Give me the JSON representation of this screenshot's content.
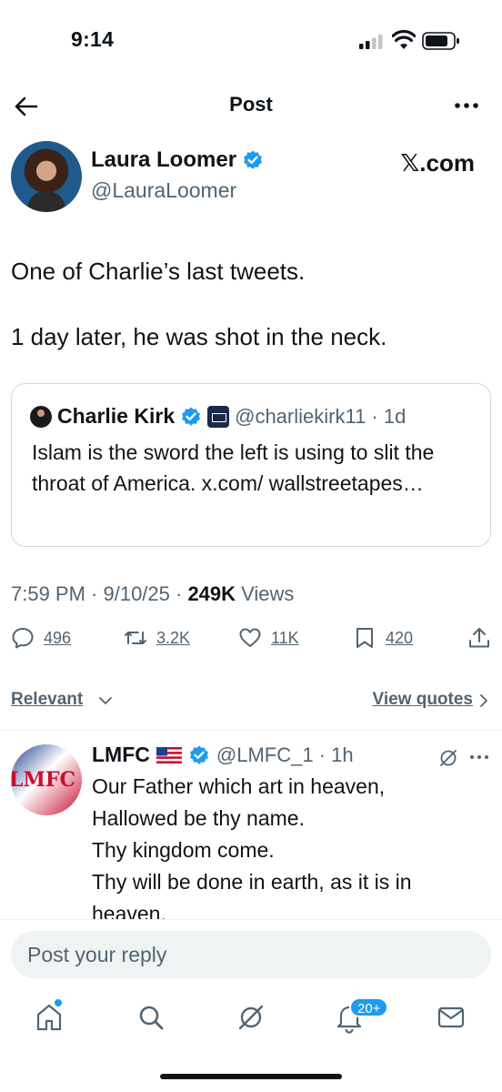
{
  "status_bar": {
    "time": "9:14"
  },
  "header": {
    "title": "Post"
  },
  "author": {
    "name": "Laura Loomer",
    "handle": "@LauraLoomer",
    "source": "𝕏.com"
  },
  "tweet": {
    "paragraphs": [
      "One of Charlie’s last tweets.",
      "1 day later, he was shot in the neck."
    ]
  },
  "quoted": {
    "name": "Charlie Kirk",
    "handle_time": "@charliekirk11 · 1d",
    "text": "Islam is the sword the left is using to slit the throat of America. x.com/ wallstreetapes…"
  },
  "meta": {
    "time_date": "7:59 PM · 9/10/25 · ",
    "views_count": "249K",
    "views_label": " Views"
  },
  "actions": {
    "replies": "496",
    "reposts": "3.2K",
    "likes": "11K",
    "bookmarks": "420"
  },
  "sort": {
    "relevant_label": "Relevant",
    "view_quotes_label": "View quotes"
  },
  "reply": {
    "name": "LMFC",
    "handle_time": "@LMFC_1 · 1h",
    "avatar_text": "LMFC",
    "lines": [
      "Our Father which art in heaven,",
      "Hallowed be thy name.",
      "Thy kingdom come.",
      "Thy will be done in earth, as it is in",
      "heaven."
    ]
  },
  "composer": {
    "placeholder": "Post your reply"
  },
  "tabbar": {
    "notifications_badge": "20+"
  },
  "colors": {
    "accent": "#1d9bf0",
    "text": "#0f1419",
    "secondary": "#536471",
    "border": "#cfd9de"
  }
}
